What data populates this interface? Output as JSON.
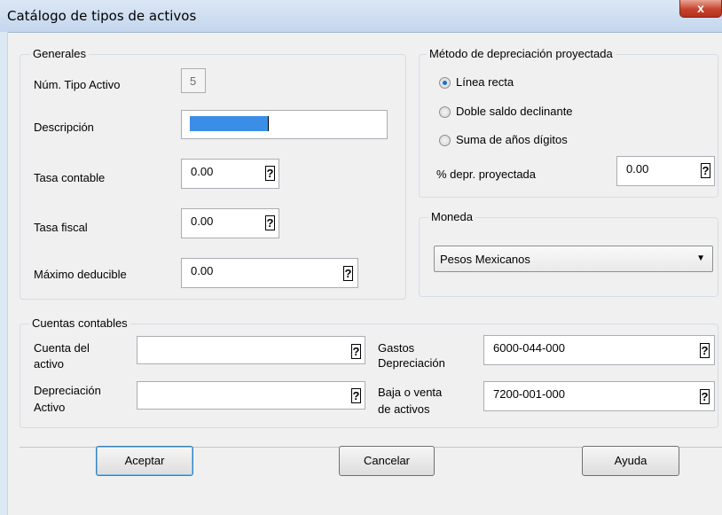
{
  "window": {
    "title": "Catálogo de tipos de activos",
    "close": "x"
  },
  "generales": {
    "label": "Generales",
    "num_tipo_label": "Núm. Tipo Activo",
    "num_tipo_value": "5",
    "descripcion_label": "Descripción",
    "descripcion_value": "",
    "tasa_contable_label": "Tasa contable",
    "tasa_contable_value": "0.00",
    "tasa_fiscal_label": "Tasa fiscal",
    "tasa_fiscal_value": "0.00",
    "maximo_label": "Máximo deducible",
    "maximo_value": "0.00"
  },
  "metodo": {
    "label": "Método de depreciación proyectada",
    "options": [
      "Línea  recta",
      "Doble saldo declinante",
      "Suma de años dígitos"
    ],
    "selected": "Línea  recta",
    "pct_label": "% depr. proyectada",
    "pct_value": "0.00"
  },
  "moneda": {
    "label": "Moneda",
    "selected": "Pesos Mexicanos"
  },
  "cuentas": {
    "label": "Cuentas contables",
    "cuenta_activo_label_1": "Cuenta del",
    "cuenta_activo_label_2": "activo",
    "cuenta_activo_value": "",
    "depreciacion_label_1": "Depreciación",
    "depreciacion_label_2": "Activo",
    "depreciacion_value": "",
    "gastos_label_1": "Gastos",
    "gastos_label_2": "Depreciación",
    "gastos_value": "6000-044-000",
    "baja_label_1": "Baja o venta",
    "baja_label_2": "de activos",
    "baja_value": "7200-001-000"
  },
  "help_glyph": "?",
  "dropdown_glyph": "▼",
  "buttons": {
    "accept": "Aceptar",
    "cancel": "Cancelar",
    "help": "Ayuda"
  },
  "colors": {
    "selection": "#3a8ee6",
    "radio_dot": "#1f6fd6"
  }
}
